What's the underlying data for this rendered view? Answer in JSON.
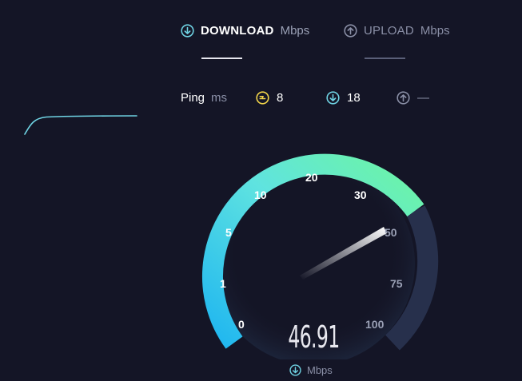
{
  "tabs": [
    {
      "label": "DOWNLOAD",
      "unit": "Mbps",
      "active": true
    },
    {
      "label": "UPLOAD",
      "unit": "Mbps",
      "active": false
    }
  ],
  "ping": {
    "label": "Ping",
    "unit": "ms",
    "idle_value": "8",
    "download_value": "18",
    "upload_value": "—"
  },
  "gauge": {
    "ticks": [
      "0",
      "1",
      "5",
      "10",
      "20",
      "30",
      "50",
      "75",
      "100"
    ],
    "needle_at_label": "50"
  },
  "result": {
    "value": "46.91",
    "unit": "Mbps"
  },
  "colors": {
    "background": "#141526",
    "accent_cyan": "#6fd3e3",
    "accent_yellow": "#f2d54a",
    "arc_start": "#1fb6f0",
    "arc_end": "#6df5a3",
    "arc_track": "#27304c"
  }
}
